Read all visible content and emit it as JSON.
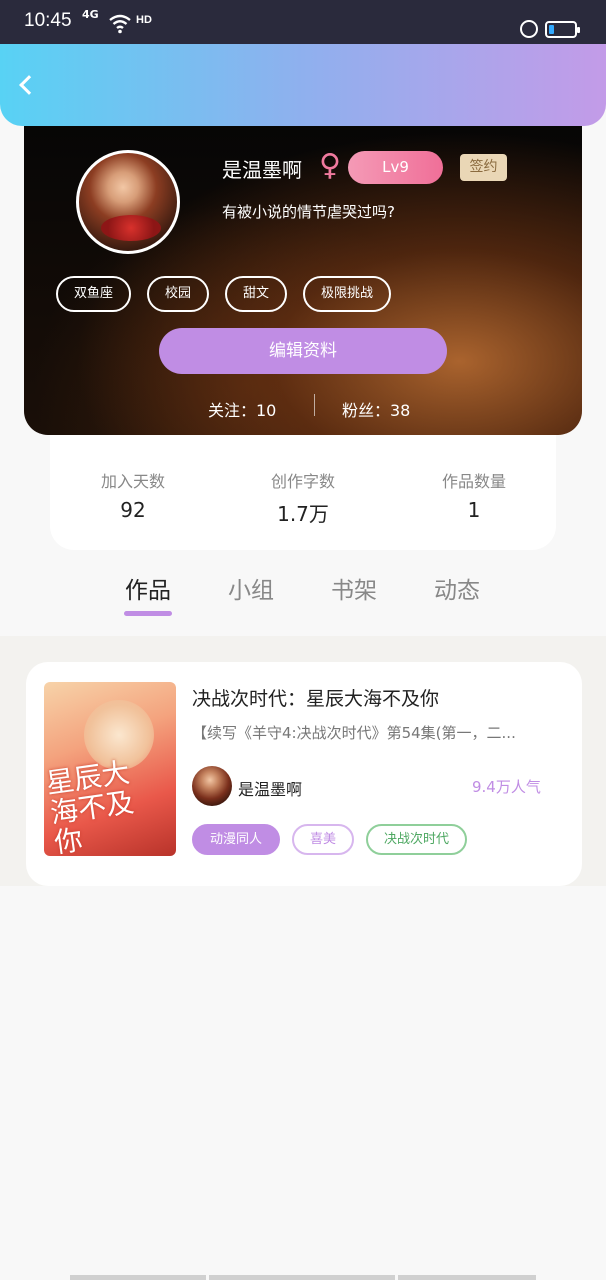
{
  "status_bar": {
    "time": "10:45",
    "network": "4G",
    "hd": "HD"
  },
  "header": {
    "back_icon": "chevron-left-icon"
  },
  "profile": {
    "username": "是温墨啊",
    "gender_symbol": "♀",
    "level": "Lv9",
    "signed_badge": "签约",
    "motto": "有被小说的情节虐哭过吗?",
    "tags": [
      "双鱼座",
      "校园",
      "甜文",
      "极限挑战"
    ],
    "edit_button": "编辑资料",
    "follow_text": "关注：10",
    "fans_text": "粉丝：38"
  },
  "stats": [
    {
      "label": "加入天数",
      "value": "92"
    },
    {
      "label": "创作字数",
      "value": "1.7万"
    },
    {
      "label": "作品数量",
      "value": "1"
    }
  ],
  "tabs": [
    {
      "label": "作品",
      "active": true
    },
    {
      "label": "小组",
      "active": false
    },
    {
      "label": "书架",
      "active": false
    },
    {
      "label": "动态",
      "active": false
    }
  ],
  "works": [
    {
      "title": "决战次时代：星辰大海不及你",
      "description": "【续写《羊守4:决战次时代》第54集(第一，二...",
      "cover_text": "星辰大海不及你",
      "author": "是温墨啊",
      "popularity": "9.4万人气",
      "tags": [
        "动漫同人",
        "喜美",
        "决战次时代"
      ]
    }
  ],
  "colors": {
    "accent": "#c08de4",
    "gender": "#f07a9e",
    "level_badge": "#f06f98"
  }
}
